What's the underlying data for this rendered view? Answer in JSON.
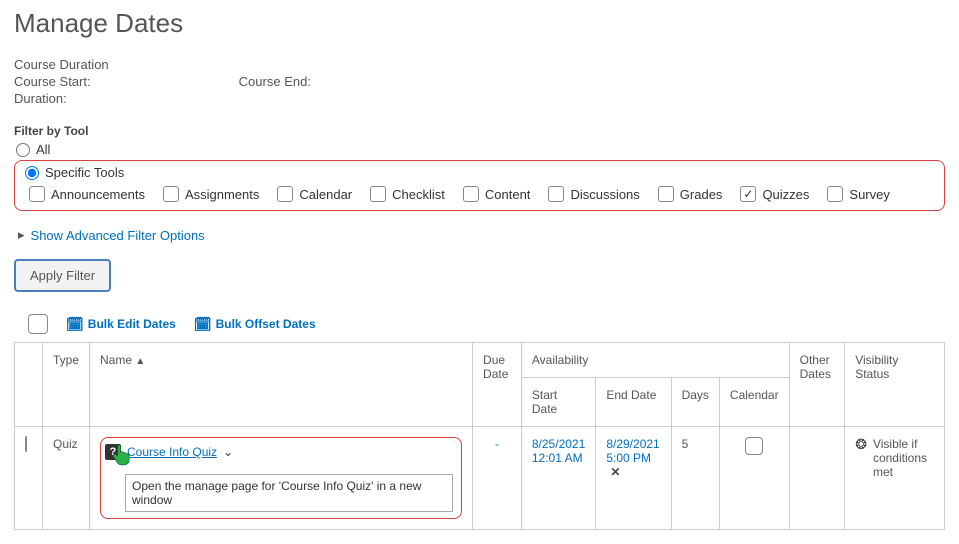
{
  "page": {
    "title": "Manage Dates"
  },
  "course": {
    "duration_label": "Course Duration",
    "start_label": "Course Start:",
    "end_label": "Course End:",
    "duration_line_label": "Duration:"
  },
  "filter": {
    "section_label": "Filter by Tool",
    "all_label": "All",
    "specific_label": "Specific Tools",
    "tools": {
      "announcements": "Announcements",
      "assignments": "Assignments",
      "calendar": "Calendar",
      "checklist": "Checklist",
      "content": "Content",
      "discussions": "Discussions",
      "grades": "Grades",
      "quizzes": "Quizzes",
      "survey": "Survey"
    },
    "advanced_label": "Show Advanced Filter Options",
    "apply_label": "Apply Filter"
  },
  "bulk": {
    "edit_label": "Bulk Edit Dates",
    "offset_label": "Bulk Offset Dates"
  },
  "table": {
    "headers": {
      "type": "Type",
      "name": "Name",
      "due": "Due Date",
      "availability": "Availability",
      "start": "Start Date",
      "end": "End Date",
      "days": "Days",
      "calendar": "Calendar",
      "other": "Other Dates",
      "visibility": "Visibility Status"
    },
    "row": {
      "type": "Quiz",
      "name": "Course Info Quiz",
      "due": "-",
      "start_date": "8/25/2021",
      "start_time": "12:01 AM",
      "end_date": "8/29/2021",
      "end_time": "5:00 PM",
      "days": "5",
      "visibility": "Visible if conditions met"
    }
  },
  "tooltip": {
    "text": "Open the manage page for 'Course Info Quiz' in a new window"
  }
}
